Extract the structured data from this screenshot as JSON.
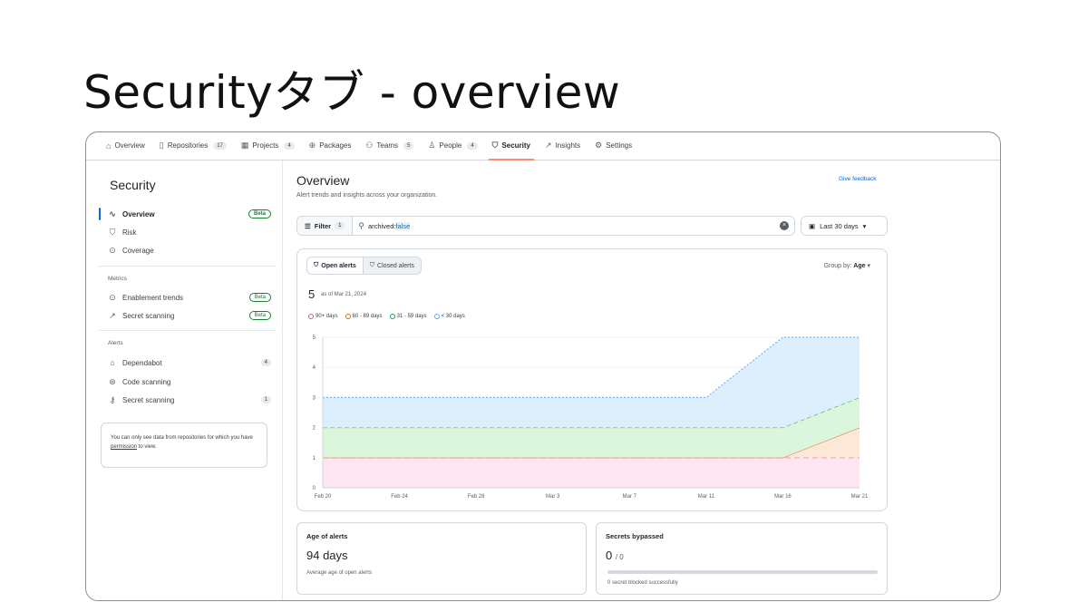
{
  "slide": {
    "title": "Securityタブ - overview"
  },
  "nav": {
    "tabs": [
      {
        "label": "Overview",
        "icon": "home-icon",
        "glyph": "⌂",
        "count": ""
      },
      {
        "label": "Repositories",
        "icon": "repo-icon",
        "glyph": "▯",
        "count": "17"
      },
      {
        "label": "Projects",
        "icon": "project-icon",
        "glyph": "▦",
        "count": "4"
      },
      {
        "label": "Packages",
        "icon": "package-icon",
        "glyph": "⊕",
        "count": ""
      },
      {
        "label": "Teams",
        "icon": "people-icon",
        "glyph": "⚇",
        "count": "5"
      },
      {
        "label": "People",
        "icon": "person-icon",
        "glyph": "♙",
        "count": "4"
      },
      {
        "label": "Security",
        "icon": "shield-icon",
        "glyph": "⛉",
        "count": ""
      },
      {
        "label": "Insights",
        "icon": "graph-icon",
        "glyph": "↗",
        "count": ""
      },
      {
        "label": "Settings",
        "icon": "gear-icon",
        "glyph": "⚙",
        "count": ""
      }
    ],
    "active_index": 6
  },
  "sidebar": {
    "title": "Security",
    "items": [
      {
        "label": "Overview",
        "icon": "pulse-icon",
        "glyph": "∿",
        "badge": "Beta"
      },
      {
        "label": "Risk",
        "icon": "shield-icon",
        "glyph": "⛉",
        "badge": ""
      },
      {
        "label": "Coverage",
        "icon": "circle-check-icon",
        "glyph": "⊙",
        "badge": ""
      }
    ],
    "metrics_heading": "Metrics",
    "metrics": [
      {
        "label": "Enablement trends",
        "icon": "circle-check-icon",
        "glyph": "⊙",
        "badge": "Beta"
      },
      {
        "label": "Secret scanning",
        "icon": "graph-icon",
        "glyph": "↗",
        "badge": "Beta"
      }
    ],
    "alerts_heading": "Alerts",
    "alerts": [
      {
        "label": "Dependabot",
        "icon": "dependabot-icon",
        "glyph": "⌂",
        "count": "4"
      },
      {
        "label": "Code scanning",
        "icon": "codescan-icon",
        "glyph": "⊛",
        "count": ""
      },
      {
        "label": "Secret scanning",
        "icon": "key-icon",
        "glyph": "⚷",
        "count": "1"
      }
    ],
    "note_prefix": "You can only see data from repositories for which you have ",
    "note_link": "permission",
    "note_suffix": " to view."
  },
  "main": {
    "title": "Overview",
    "subtitle": "Alert trends and insights across your organization.",
    "feedback": "Give feedback",
    "filter_label": "Filter",
    "filter_count": "1",
    "search_key": "archived:",
    "search_value": "false",
    "date_range": "Last 30 days"
  },
  "chart_card": {
    "tab_open": "Open alerts",
    "tab_closed": "Closed alerts",
    "groupby_label": "Group by:",
    "groupby_value": "Age",
    "total": "5",
    "as_of": "as of Mar 21, 2024",
    "legend": [
      {
        "label": "90+ days",
        "color": "#cf5a9b"
      },
      {
        "label": "60 - 89 days",
        "color": "#d4701f"
      },
      {
        "label": "31 - 59 days",
        "color": "#2da44e"
      },
      {
        "label": "< 30 days",
        "color": "#54aeff"
      }
    ]
  },
  "chart_data": {
    "type": "area",
    "stacked": true,
    "x": [
      "Feb 20",
      "Mar 11",
      "Mar 16",
      "Mar 21"
    ],
    "xticks": [
      "Feb 20",
      "Feb 24",
      "Feb 28",
      "Mar 3",
      "Mar 7",
      "Mar 11",
      "Mar 16",
      "Mar 21"
    ],
    "yticks": [
      "0",
      "1",
      "2",
      "3",
      "4",
      "5"
    ],
    "ylim": [
      0,
      5
    ],
    "series": [
      {
        "name": "90+ days",
        "values": [
          1,
          1,
          1,
          1
        ],
        "color": "#cf5a9b",
        "fill": "#fde6f1"
      },
      {
        "name": "60 - 89 days",
        "values": [
          0,
          0,
          0,
          1
        ],
        "color": "#d4701f",
        "fill": "#fde7d7"
      },
      {
        "name": "31 - 59 days",
        "values": [
          1,
          1,
          1,
          1
        ],
        "color": "#2da44e",
        "fill": "#dcf6dd"
      },
      {
        "name": "< 30 days",
        "values": [
          1,
          1,
          3,
          2
        ],
        "color": "#54aeff",
        "fill": "#ddeefd"
      }
    ],
    "grid": true
  },
  "cards": {
    "age": {
      "title": "Age of alerts",
      "value": "94 days",
      "desc": "Average age of open alerts"
    },
    "secrets": {
      "title": "Secrets bypassed",
      "value": "0",
      "value_total": "/ 0",
      "desc": "0 secret blocked successfully",
      "progress": 0
    }
  }
}
